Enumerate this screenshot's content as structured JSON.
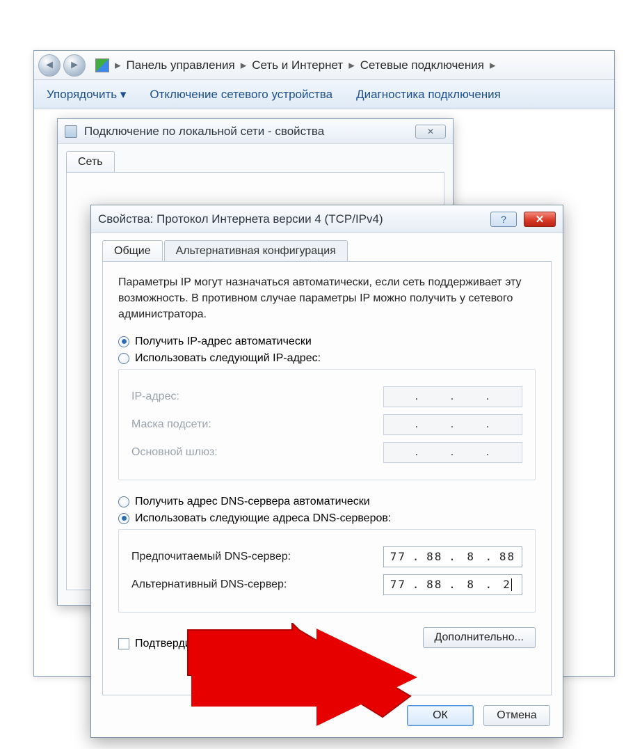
{
  "explorer": {
    "breadcrumb": {
      "item1": "Панель управления",
      "item2": "Сеть и Интернет",
      "item3": "Сетевые подключения"
    },
    "toolbar": {
      "organize": "Упорядочить ▾",
      "disable": "Отключение сетевого устройства",
      "diagnose": "Диагностика подключения"
    }
  },
  "conn_dialog": {
    "title": "Подключение по локальной сети - свойства",
    "tab_network": "Сеть"
  },
  "ipv4_dialog": {
    "title": "Свойства: Протокол Интернета версии 4 (TCP/IPv4)",
    "tab_general": "Общие",
    "tab_alt": "Альтернативная конфигурация",
    "description": "Параметры IP могут назначаться автоматически, если сеть поддерживает эту возможность. В противном случае параметры IP можно получить у сетевого администратора.",
    "radio_ip_auto": "Получить IP-адрес автоматически",
    "radio_ip_manual": "Использовать следующий IP-адрес:",
    "label_ip": "IP-адрес:",
    "label_mask": "Маска подсети:",
    "label_gateway": "Основной шлюз:",
    "radio_dns_auto": "Получить адрес DNS-сервера автоматически",
    "radio_dns_manual": "Использовать следующие адреса DNS-серверов:",
    "label_dns_pref": "Предпочитаемый DNS-сервер:",
    "label_dns_alt": "Альтернативный DNS-сервер:",
    "dns_pref": {
      "o1": "77",
      "o2": "88",
      "o3": "8",
      "o4": "88"
    },
    "dns_alt": {
      "o1": "77",
      "o2": "88",
      "o3": "8",
      "o4": "2"
    },
    "chk_validate": "Подтвердить параметры при выходе",
    "btn_advanced": "Дополнительно...",
    "btn_ok": "ОК",
    "btn_cancel": "Отмена"
  }
}
